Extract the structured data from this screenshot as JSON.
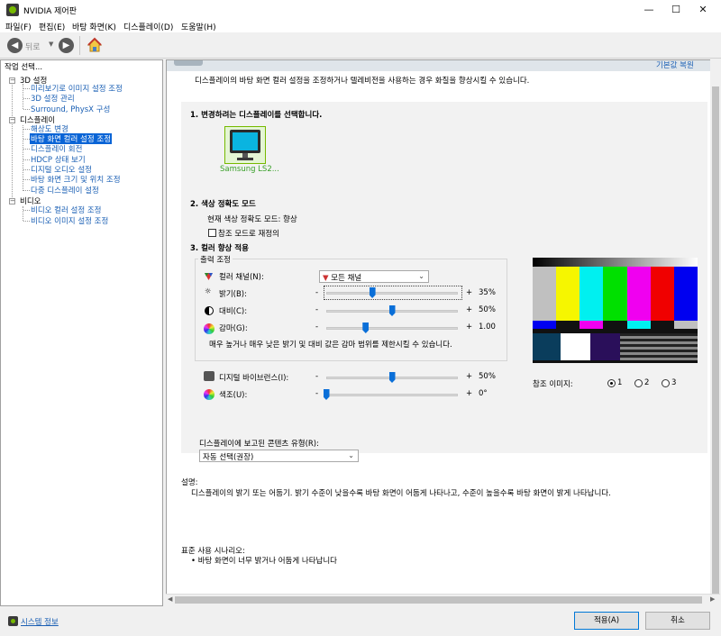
{
  "window": {
    "title": "NVIDIA 제어판",
    "minimize": "—",
    "maximize": "☐",
    "close": "✕"
  },
  "menu": [
    "파일(F)",
    "편집(E)",
    "바탕 화면(K)",
    "디스플레이(D)",
    "도움말(H)"
  ],
  "toolbar": {
    "back_label": "뒤로",
    "back_icon": "arrow-left-icon",
    "forward_icon": "arrow-right-icon",
    "home_icon": "home-icon"
  },
  "left": {
    "header": "작업 선택...",
    "tree": [
      {
        "label": "3D 설정",
        "level": 0
      },
      {
        "label": "미리보기로 이미지 설정 조정",
        "level": 1
      },
      {
        "label": "3D 설정 관리",
        "level": 1
      },
      {
        "label": "Surround, PhysX 구성",
        "level": 1
      },
      {
        "label": "디스플레이",
        "level": 0
      },
      {
        "label": "해상도 변경",
        "level": 1
      },
      {
        "label": "바탕 화면 컬러 설정 조정",
        "level": 1,
        "selected": true
      },
      {
        "label": "디스플레이 회전",
        "level": 1
      },
      {
        "label": "HDCP 상태 보기",
        "level": 1
      },
      {
        "label": "디지털 오디오 설정",
        "level": 1
      },
      {
        "label": "바탕 화면 크기 및 위치 조정",
        "level": 1
      },
      {
        "label": "다중 디스플레이 설정",
        "level": 1
      },
      {
        "label": "비디오",
        "level": 0
      },
      {
        "label": "비디오 컬러 설정 조정",
        "level": 1
      },
      {
        "label": "비디오 이미지 설정 조정",
        "level": 1
      }
    ],
    "system_info": "시스템 정보"
  },
  "main": {
    "restore_defaults": "기본값 복원",
    "intro": "디스플레이의 바탕 화면 컬러 설정을 조정하거나 텔레비전을 사용하는 경우 화질을 향상시킬 수 있습니다.",
    "step1": "1. 변경하려는 디스플레이를 선택합니다.",
    "display_name": "Samsung LS2...",
    "step2": "2. 색상 정확도 모드",
    "current_mode": "현재 색상 정확도 모드: 향상",
    "reference_mode": "참조 모드로 재정의",
    "reference_checked": false,
    "step3": "3. 컬러 향상 적용",
    "output_group": "출력 조정",
    "channel_label": "컬러 채널(N):",
    "channel_value": "모든 채널",
    "brightness_label": "밝기(B):",
    "brightness_value": "35%",
    "brightness_level": 0.35,
    "contrast_label": "대비(C):",
    "contrast_value": "50%",
    "contrast_level": 0.5,
    "gamma_label": "감마(G):",
    "gamma_value": "1.00",
    "gamma_level": 0.3,
    "minus": "-",
    "plus": "+",
    "warning": "매우 높거나 매우 낮은 밝기 및 대비 값은 감마 범위를 제한시킬 수 있습니다.",
    "vibrance_label": "디지털 바이브런스(I):",
    "vibrance_value": "50%",
    "vibrance_level": 0.5,
    "hue_label": "색조(U):",
    "hue_value": "0°",
    "hue_level": 0.0,
    "reference_image_label": "참조 이미지:",
    "ref_options": [
      "1",
      "2",
      "3"
    ],
    "ref_selected": 0,
    "content_type_label": "디스플레이에 보고된 콘텐츠 유형(R):",
    "content_type_value": "자동 선택(권장)",
    "desc_title": "설명:",
    "desc_text": "디스플레이의 밝기 또는 어둡기. 밝기 수준이 낮을수록 바탕 화면이 어둡게 나타나고, 수준이 높을수록 바탕 화면이 밝게 나타납니다.",
    "usage_title": "표준 사용 시나리오:",
    "usage_item": "• 바탕 화면이 너무 밝거나 어둡게 나타납니다"
  },
  "buttons": {
    "apply": "적용(A)",
    "cancel": "취소"
  },
  "colors": {
    "accent": "#0a64d6",
    "slider": "#0a6fd8",
    "nvidia_green": "#76b900"
  }
}
